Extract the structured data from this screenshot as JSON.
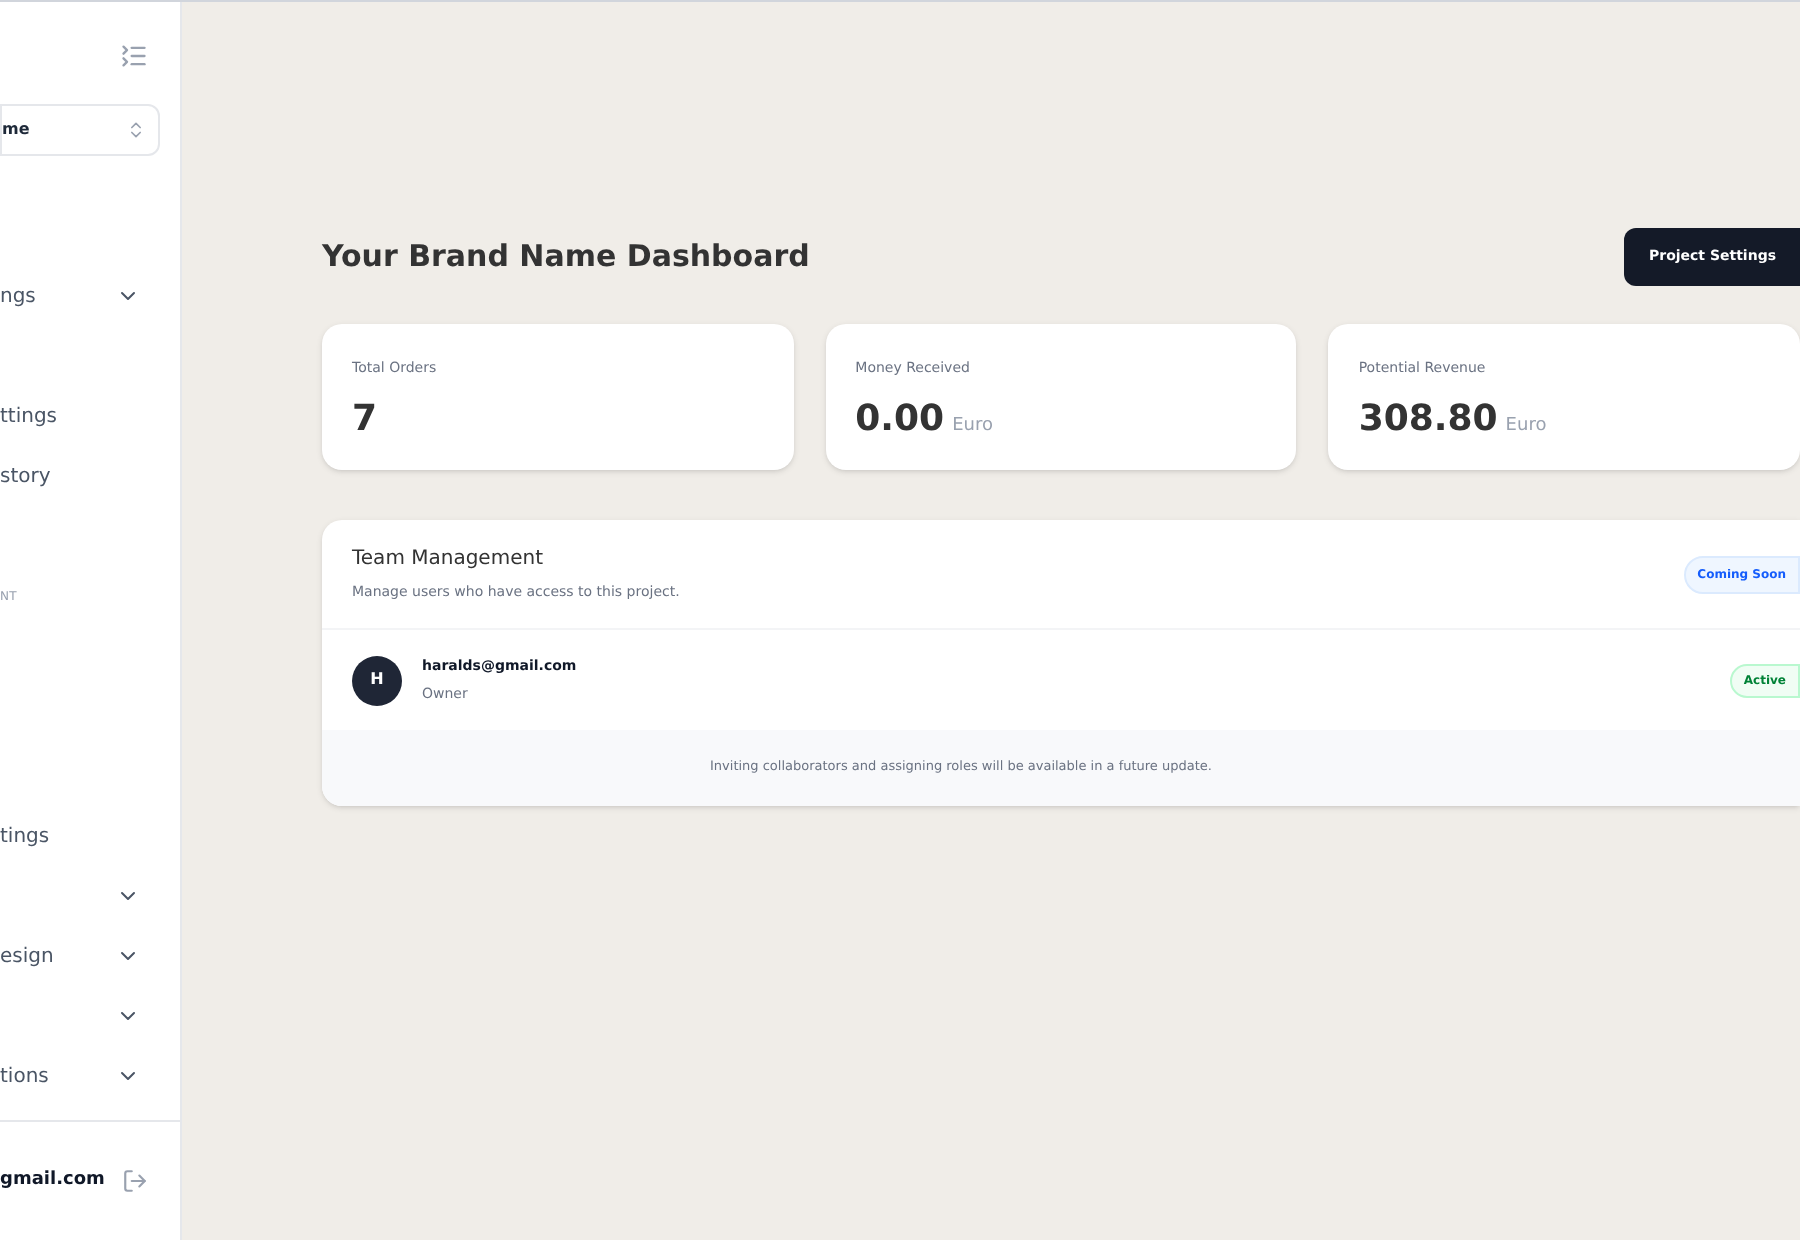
{
  "sidebar": {
    "project_select": {
      "value": "me"
    },
    "items": [
      {
        "kind": "group",
        "label": "ngs",
        "expanded": false
      },
      {
        "kind": "spacer"
      },
      {
        "kind": "link",
        "label": "ttings"
      },
      {
        "kind": "link",
        "label": "story"
      },
      {
        "kind": "spacer"
      },
      {
        "kind": "section",
        "label": "NT"
      },
      {
        "kind": "spacer"
      },
      {
        "kind": "spacer"
      },
      {
        "kind": "spacer"
      },
      {
        "kind": "link",
        "label": "tings"
      },
      {
        "kind": "group",
        "expanded": false
      },
      {
        "kind": "group",
        "label": "esign",
        "expanded": false
      },
      {
        "kind": "group",
        "expanded": false
      },
      {
        "kind": "group",
        "label": "tions",
        "expanded": false
      }
    ],
    "user": {
      "email": "gmail.com"
    }
  },
  "main": {
    "title": "Your Brand Name Dashboard",
    "action_button": "Project Settings",
    "stats": [
      {
        "label": "Total Orders",
        "value": "7"
      },
      {
        "label": "Money Received",
        "value": "0.00",
        "unit": "Euro"
      },
      {
        "label": "Potential Revenue",
        "value": "308.80",
        "unit": "Euro"
      }
    ],
    "team": {
      "title": "Team Management",
      "subtitle": "Manage users who have access to this project.",
      "badge": "Coming Soon",
      "members": [
        {
          "initial": "H",
          "email": "haralds@gmail.com",
          "role": "Owner",
          "status": "Active"
        }
      ],
      "footer_note": "Inviting collaborators and assigning roles will be available in a future update."
    }
  }
}
